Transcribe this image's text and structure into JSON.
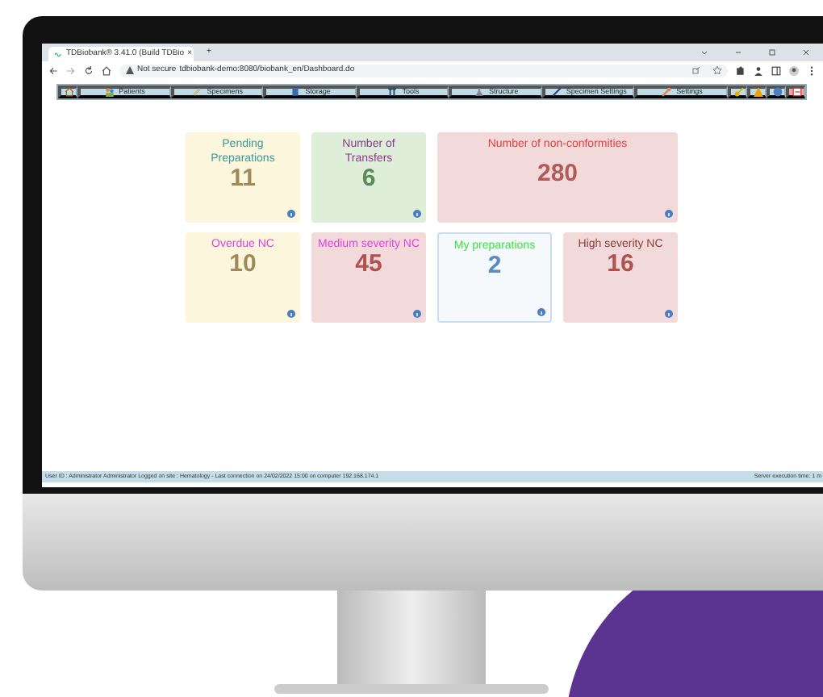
{
  "browser": {
    "tab_title": "TDBiobank® 3.41.0 (Build TDBio",
    "tab_close": "×",
    "new_tab": "+",
    "security": "Not secure",
    "url": "tdbiobank-demo:8080/biobank_en/Dashboard.do"
  },
  "menu": [
    {
      "label": "Patients"
    },
    {
      "label": "Specimens"
    },
    {
      "label": "Storage"
    },
    {
      "label": "Tools"
    },
    {
      "label": "Structure"
    },
    {
      "label": "Specimen Settings"
    },
    {
      "label": "Settings"
    }
  ],
  "tiles": [
    {
      "title": "Pending Preparations",
      "value": "11",
      "color": "#fbf6dc",
      "wide": false
    },
    {
      "title": "Number of Transfers",
      "value": "6",
      "color": "#dfeed8",
      "wide": false
    },
    {
      "title": "Number of non-conformities",
      "value": "280",
      "color": "#f2dada",
      "wide": true
    },
    {
      "title": "Overdue NC",
      "value": "10",
      "color": "#fbf6dc",
      "wide": false
    },
    {
      "title": "Medium severity NC",
      "value": "45",
      "color": "#f2dada",
      "wide": false
    },
    {
      "title": "My preparations",
      "value": "2",
      "color": "#f5f9fc",
      "wide": false
    },
    {
      "title": "High severity NC",
      "value": "16",
      "color": "#f2dada",
      "wide": false
    }
  ],
  "status_bar": {
    "left": "User ID : Administrator Administrator Logged on site : Hematology - Last connection on 24/02/2022 15:00 on computer 192.168.174.1",
    "right": "Server execution time: 1 m"
  }
}
